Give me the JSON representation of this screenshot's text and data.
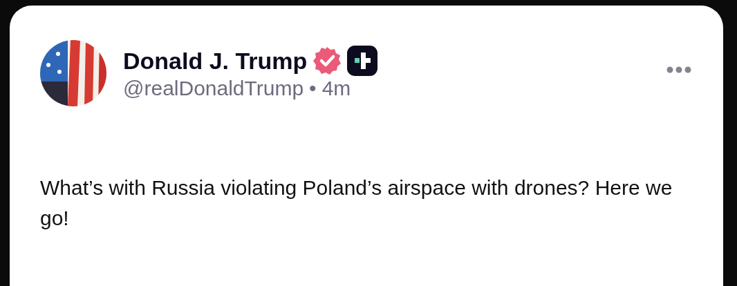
{
  "post": {
    "author": {
      "name": "Donald J. Trump",
      "verified": true,
      "handle": "@realDonaldTrump",
      "separator": "•",
      "time": "4m"
    },
    "text": "What’s with Russia violating Poland’s airspace with drones? Here we go!"
  }
}
